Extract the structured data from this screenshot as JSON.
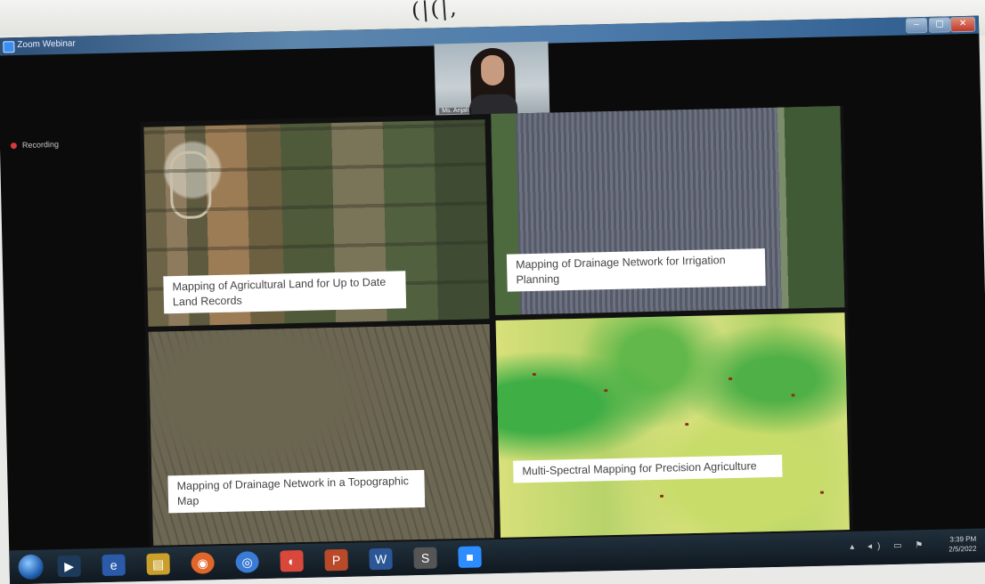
{
  "handwriting": "(|(|,",
  "window": {
    "title": "Zoom Webinar",
    "controls": [
      "–",
      "▢",
      "✕"
    ]
  },
  "recording": {
    "label": "Recording"
  },
  "video": {
    "participant_name": "Ms. Anjali"
  },
  "slide": {
    "panels": [
      {
        "caption": "Mapping of Agricultural Land for Up to Date Land Records"
      },
      {
        "caption": "Mapping of Drainage Network for Irrigation Planning"
      },
      {
        "caption": "Mapping of Drainage Network in a Topographic Map"
      },
      {
        "caption": "Multi-Spectral Mapping for Precision Agriculture"
      }
    ]
  },
  "taskbar": {
    "icons": [
      {
        "name": "start-orb",
        "glyph": ""
      },
      {
        "name": "media-player-icon",
        "glyph": "▶"
      },
      {
        "name": "internet-explorer-icon",
        "glyph": "e"
      },
      {
        "name": "file-explorer-icon",
        "glyph": "▤"
      },
      {
        "name": "firefox-icon",
        "glyph": "◉"
      },
      {
        "name": "chrome-icon",
        "glyph": "◎"
      },
      {
        "name": "google-chrome-icon",
        "glyph": "◐"
      },
      {
        "name": "powerpoint-icon",
        "glyph": "P"
      },
      {
        "name": "word-icon",
        "glyph": "W"
      },
      {
        "name": "app-icon",
        "glyph": "S"
      },
      {
        "name": "zoom-icon",
        "glyph": "■"
      }
    ],
    "colors": [
      "#1e3a5a",
      "#2b5aa8",
      "#2f7fd1",
      "#caa02a",
      "#e0662a",
      "#3a7bd5",
      "#d9483b",
      "#b84a2a",
      "#2b5797",
      "#555",
      "#2d8cff"
    ],
    "tray": {
      "time": "3:39 PM",
      "date": "2/5/2022",
      "icons": "▴ ◂) ▭ ⚑"
    }
  }
}
